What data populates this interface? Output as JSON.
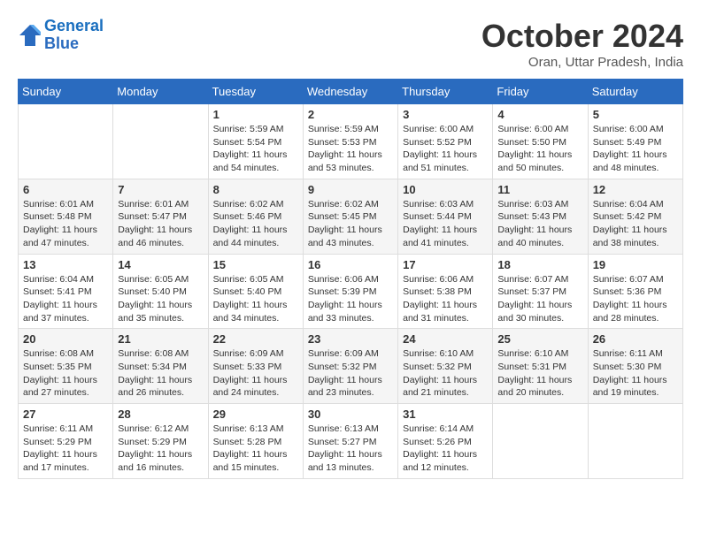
{
  "header": {
    "logo_line1": "General",
    "logo_line2": "Blue",
    "month_title": "October 2024",
    "subtitle": "Oran, Uttar Pradesh, India"
  },
  "days_of_week": [
    "Sunday",
    "Monday",
    "Tuesday",
    "Wednesday",
    "Thursday",
    "Friday",
    "Saturday"
  ],
  "weeks": [
    [
      {
        "day": "",
        "sunrise": "",
        "sunset": "",
        "daylight": ""
      },
      {
        "day": "",
        "sunrise": "",
        "sunset": "",
        "daylight": ""
      },
      {
        "day": "1",
        "sunrise": "Sunrise: 5:59 AM",
        "sunset": "Sunset: 5:54 PM",
        "daylight": "Daylight: 11 hours and 54 minutes."
      },
      {
        "day": "2",
        "sunrise": "Sunrise: 5:59 AM",
        "sunset": "Sunset: 5:53 PM",
        "daylight": "Daylight: 11 hours and 53 minutes."
      },
      {
        "day": "3",
        "sunrise": "Sunrise: 6:00 AM",
        "sunset": "Sunset: 5:52 PM",
        "daylight": "Daylight: 11 hours and 51 minutes."
      },
      {
        "day": "4",
        "sunrise": "Sunrise: 6:00 AM",
        "sunset": "Sunset: 5:50 PM",
        "daylight": "Daylight: 11 hours and 50 minutes."
      },
      {
        "day": "5",
        "sunrise": "Sunrise: 6:00 AM",
        "sunset": "Sunset: 5:49 PM",
        "daylight": "Daylight: 11 hours and 48 minutes."
      }
    ],
    [
      {
        "day": "6",
        "sunrise": "Sunrise: 6:01 AM",
        "sunset": "Sunset: 5:48 PM",
        "daylight": "Daylight: 11 hours and 47 minutes."
      },
      {
        "day": "7",
        "sunrise": "Sunrise: 6:01 AM",
        "sunset": "Sunset: 5:47 PM",
        "daylight": "Daylight: 11 hours and 46 minutes."
      },
      {
        "day": "8",
        "sunrise": "Sunrise: 6:02 AM",
        "sunset": "Sunset: 5:46 PM",
        "daylight": "Daylight: 11 hours and 44 minutes."
      },
      {
        "day": "9",
        "sunrise": "Sunrise: 6:02 AM",
        "sunset": "Sunset: 5:45 PM",
        "daylight": "Daylight: 11 hours and 43 minutes."
      },
      {
        "day": "10",
        "sunrise": "Sunrise: 6:03 AM",
        "sunset": "Sunset: 5:44 PM",
        "daylight": "Daylight: 11 hours and 41 minutes."
      },
      {
        "day": "11",
        "sunrise": "Sunrise: 6:03 AM",
        "sunset": "Sunset: 5:43 PM",
        "daylight": "Daylight: 11 hours and 40 minutes."
      },
      {
        "day": "12",
        "sunrise": "Sunrise: 6:04 AM",
        "sunset": "Sunset: 5:42 PM",
        "daylight": "Daylight: 11 hours and 38 minutes."
      }
    ],
    [
      {
        "day": "13",
        "sunrise": "Sunrise: 6:04 AM",
        "sunset": "Sunset: 5:41 PM",
        "daylight": "Daylight: 11 hours and 37 minutes."
      },
      {
        "day": "14",
        "sunrise": "Sunrise: 6:05 AM",
        "sunset": "Sunset: 5:40 PM",
        "daylight": "Daylight: 11 hours and 35 minutes."
      },
      {
        "day": "15",
        "sunrise": "Sunrise: 6:05 AM",
        "sunset": "Sunset: 5:40 PM",
        "daylight": "Daylight: 11 hours and 34 minutes."
      },
      {
        "day": "16",
        "sunrise": "Sunrise: 6:06 AM",
        "sunset": "Sunset: 5:39 PM",
        "daylight": "Daylight: 11 hours and 33 minutes."
      },
      {
        "day": "17",
        "sunrise": "Sunrise: 6:06 AM",
        "sunset": "Sunset: 5:38 PM",
        "daylight": "Daylight: 11 hours and 31 minutes."
      },
      {
        "day": "18",
        "sunrise": "Sunrise: 6:07 AM",
        "sunset": "Sunset: 5:37 PM",
        "daylight": "Daylight: 11 hours and 30 minutes."
      },
      {
        "day": "19",
        "sunrise": "Sunrise: 6:07 AM",
        "sunset": "Sunset: 5:36 PM",
        "daylight": "Daylight: 11 hours and 28 minutes."
      }
    ],
    [
      {
        "day": "20",
        "sunrise": "Sunrise: 6:08 AM",
        "sunset": "Sunset: 5:35 PM",
        "daylight": "Daylight: 11 hours and 27 minutes."
      },
      {
        "day": "21",
        "sunrise": "Sunrise: 6:08 AM",
        "sunset": "Sunset: 5:34 PM",
        "daylight": "Daylight: 11 hours and 26 minutes."
      },
      {
        "day": "22",
        "sunrise": "Sunrise: 6:09 AM",
        "sunset": "Sunset: 5:33 PM",
        "daylight": "Daylight: 11 hours and 24 minutes."
      },
      {
        "day": "23",
        "sunrise": "Sunrise: 6:09 AM",
        "sunset": "Sunset: 5:32 PM",
        "daylight": "Daylight: 11 hours and 23 minutes."
      },
      {
        "day": "24",
        "sunrise": "Sunrise: 6:10 AM",
        "sunset": "Sunset: 5:32 PM",
        "daylight": "Daylight: 11 hours and 21 minutes."
      },
      {
        "day": "25",
        "sunrise": "Sunrise: 6:10 AM",
        "sunset": "Sunset: 5:31 PM",
        "daylight": "Daylight: 11 hours and 20 minutes."
      },
      {
        "day": "26",
        "sunrise": "Sunrise: 6:11 AM",
        "sunset": "Sunset: 5:30 PM",
        "daylight": "Daylight: 11 hours and 19 minutes."
      }
    ],
    [
      {
        "day": "27",
        "sunrise": "Sunrise: 6:11 AM",
        "sunset": "Sunset: 5:29 PM",
        "daylight": "Daylight: 11 hours and 17 minutes."
      },
      {
        "day": "28",
        "sunrise": "Sunrise: 6:12 AM",
        "sunset": "Sunset: 5:29 PM",
        "daylight": "Daylight: 11 hours and 16 minutes."
      },
      {
        "day": "29",
        "sunrise": "Sunrise: 6:13 AM",
        "sunset": "Sunset: 5:28 PM",
        "daylight": "Daylight: 11 hours and 15 minutes."
      },
      {
        "day": "30",
        "sunrise": "Sunrise: 6:13 AM",
        "sunset": "Sunset: 5:27 PM",
        "daylight": "Daylight: 11 hours and 13 minutes."
      },
      {
        "day": "31",
        "sunrise": "Sunrise: 6:14 AM",
        "sunset": "Sunset: 5:26 PM",
        "daylight": "Daylight: 11 hours and 12 minutes."
      },
      {
        "day": "",
        "sunrise": "",
        "sunset": "",
        "daylight": ""
      },
      {
        "day": "",
        "sunrise": "",
        "sunset": "",
        "daylight": ""
      }
    ]
  ]
}
